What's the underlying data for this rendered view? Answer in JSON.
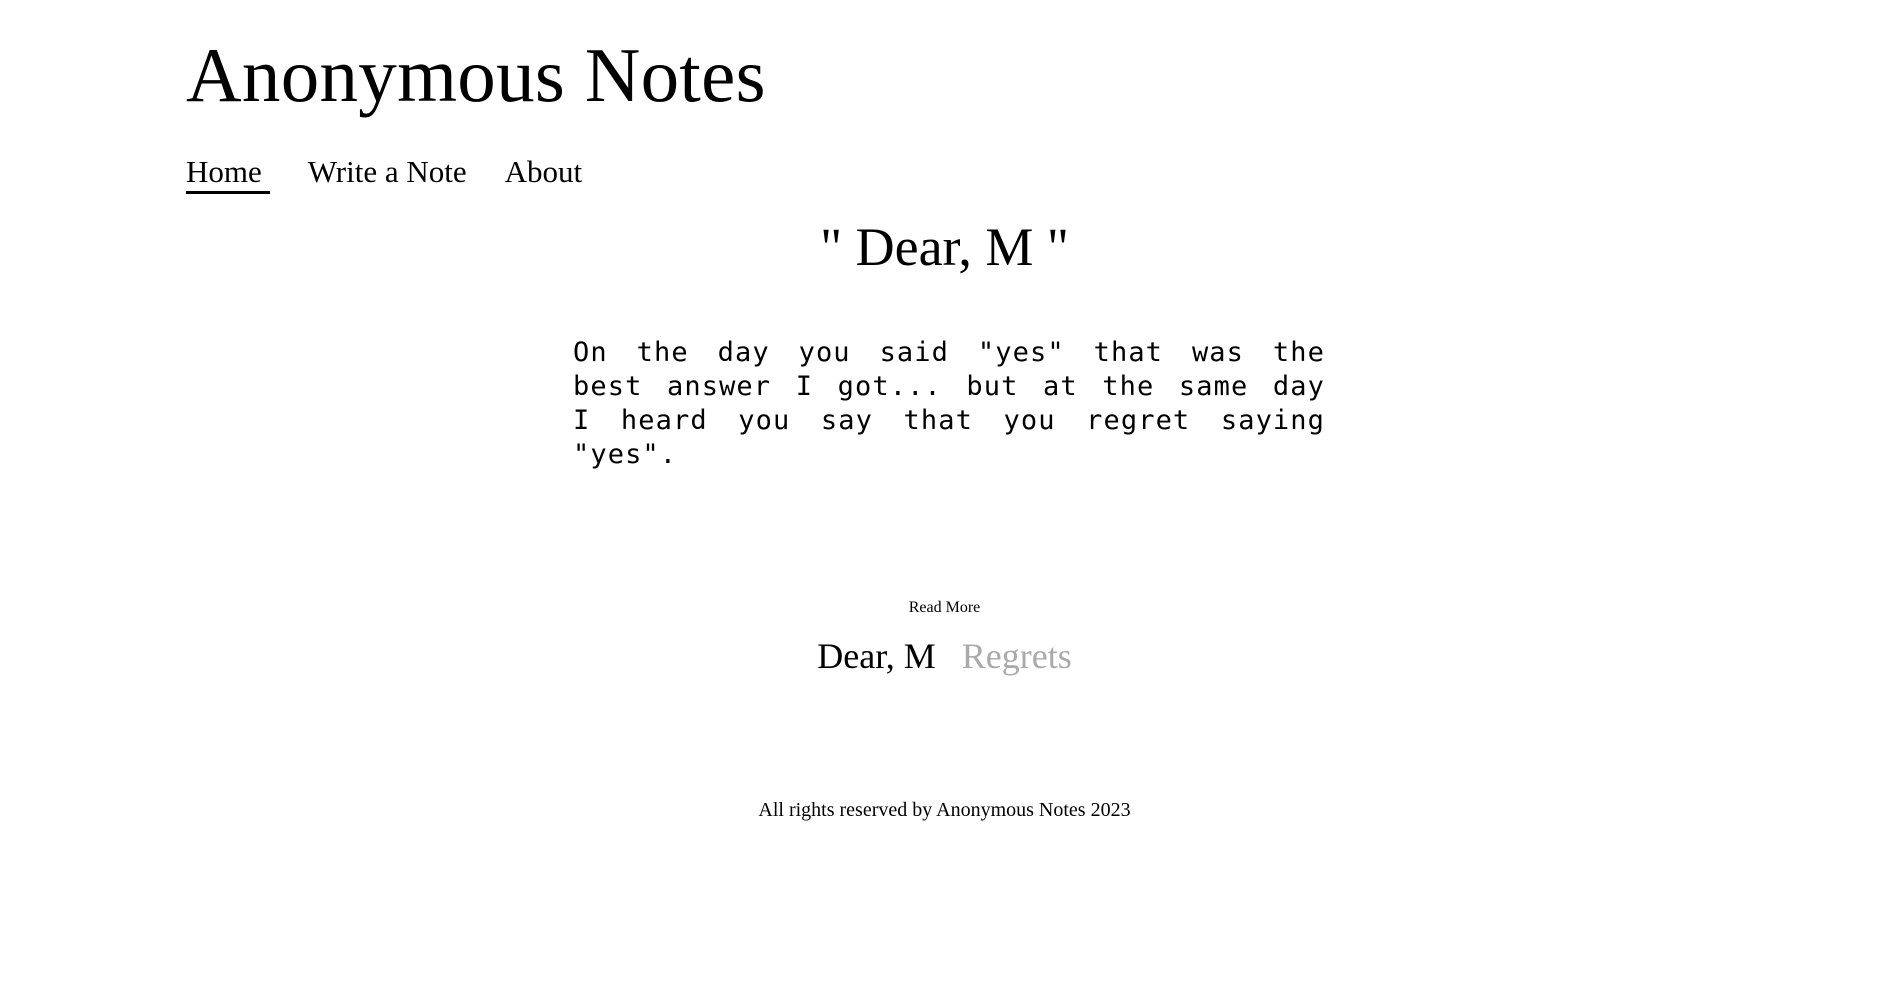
{
  "site": {
    "title": "Anonymous Notes"
  },
  "nav": {
    "items": [
      {
        "label": "Home",
        "active": true
      },
      {
        "label": "Write a Note",
        "active": false
      },
      {
        "label": "About",
        "active": false
      }
    ]
  },
  "note": {
    "title": "\" Dear, M \"",
    "body": "On the day you said \"yes\" that was the best answer I got... but at the same day I heard you say that you regret saying \"yes\"."
  },
  "read_more": {
    "label": "Read More",
    "links": [
      {
        "label": "Dear, M",
        "muted": false
      },
      {
        "label": "Regrets",
        "muted": true
      }
    ]
  },
  "footer": {
    "text": "All rights reserved by Anonymous Notes 2023"
  },
  "colors": {
    "text": "#000000",
    "muted_link": "#aaaaaa",
    "background": "#ffffff"
  }
}
